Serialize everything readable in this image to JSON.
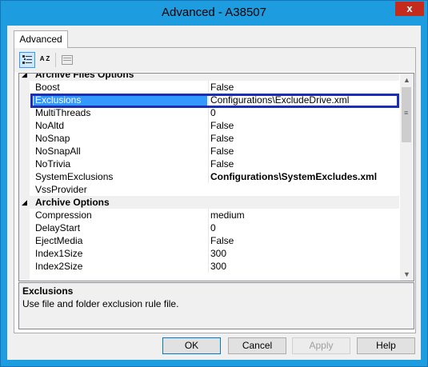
{
  "window": {
    "title": "Advanced - A38507",
    "close_label": "x"
  },
  "tab": {
    "label": "Advanced"
  },
  "toolbar": {
    "categorized_icon": "categorized-view-icon",
    "alpha_icon": "alphabetical-sort-icon",
    "alpha_label": "A Z",
    "pages_icon": "property-pages-icon"
  },
  "grid": {
    "rows": [
      {
        "type": "category",
        "toggle": "◢",
        "name": "Archive Files Options"
      },
      {
        "type": "prop",
        "name": "Boost",
        "value": "False"
      },
      {
        "type": "prop",
        "name": "Exclusions",
        "value": "Configurations\\ExcludeDrive.xml",
        "selected": true
      },
      {
        "type": "prop",
        "name": "MultiThreads",
        "value": "0"
      },
      {
        "type": "prop",
        "name": "NoAltd",
        "value": "False"
      },
      {
        "type": "prop",
        "name": "NoSnap",
        "value": "False"
      },
      {
        "type": "prop",
        "name": "NoSnapAll",
        "value": "False"
      },
      {
        "type": "prop",
        "name": "NoTrivia",
        "value": "False"
      },
      {
        "type": "prop",
        "name": "SystemExclusions",
        "value": "Configurations\\SystemExcludes.xml",
        "bold": true
      },
      {
        "type": "prop",
        "name": "VssProvider",
        "value": ""
      },
      {
        "type": "category",
        "toggle": "◢",
        "name": "Archive Options"
      },
      {
        "type": "prop",
        "name": "Compression",
        "value": "medium"
      },
      {
        "type": "prop",
        "name": "DelayStart",
        "value": "0"
      },
      {
        "type": "prop",
        "name": "EjectMedia",
        "value": "False"
      },
      {
        "type": "prop",
        "name": "Index1Size",
        "value": "300"
      },
      {
        "type": "prop",
        "name": "Index2Size",
        "value": "300"
      },
      {
        "type": "prop",
        "name": "",
        "value": ""
      }
    ]
  },
  "scrollbar": {
    "up": "▲",
    "down": "▼",
    "grip": "≡"
  },
  "help": {
    "title": "Exclusions",
    "description": "Use file and folder exclusion rule file."
  },
  "buttons": {
    "ok": "OK",
    "cancel": "Cancel",
    "apply": "Apply",
    "help": "Help"
  },
  "colors": {
    "title_bar": "#1e9ce0",
    "selection": "#3399ff",
    "highlight_box": "#1a2fb5"
  }
}
